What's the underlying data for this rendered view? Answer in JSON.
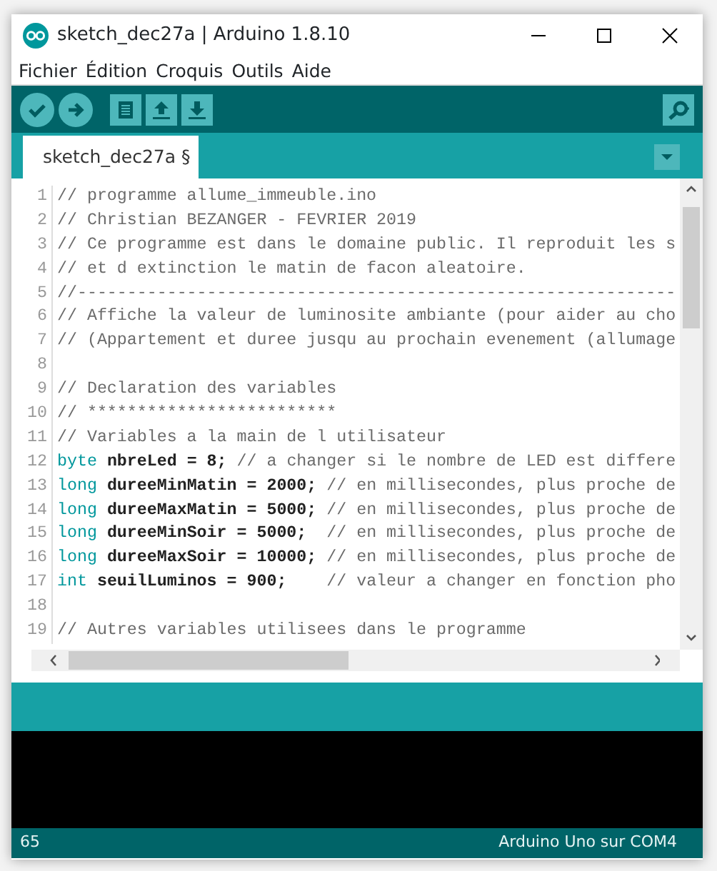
{
  "window": {
    "title": "sketch_dec27a | Arduino 1.8.10"
  },
  "menu": [
    "Fichier",
    "Édition",
    "Croquis",
    "Outils",
    "Aide"
  ],
  "tabs": [
    {
      "label": "sketch_dec27a §",
      "selected": true
    }
  ],
  "editor": {
    "lines": [
      {
        "number": "1",
        "segments": [
          {
            "kind": "comment",
            "text": "// programme allume_immeuble.ino"
          }
        ]
      },
      {
        "number": "2",
        "segments": [
          {
            "kind": "comment",
            "text": "// Christian BEZANGER - FEVRIER 2019"
          }
        ]
      },
      {
        "number": "3",
        "segments": [
          {
            "kind": "comment",
            "text": "// Ce programme est dans le domaine public. Il reproduit les s"
          }
        ]
      },
      {
        "number": "4",
        "segments": [
          {
            "kind": "comment",
            "text": "// et d extinction le matin de facon aleatoire."
          }
        ]
      },
      {
        "number": "5",
        "segments": [
          {
            "kind": "comment",
            "text": "//------------------------------------------------------------"
          }
        ]
      },
      {
        "number": "6",
        "segments": [
          {
            "kind": "comment",
            "text": "// Affiche la valeur de luminosite ambiante (pour aider au cho"
          }
        ]
      },
      {
        "number": "7",
        "segments": [
          {
            "kind": "comment",
            "text": "// (Appartement et duree jusqu au prochain evenement (allumage"
          }
        ]
      },
      {
        "number": "8"
      },
      {
        "number": "9",
        "segments": [
          {
            "kind": "comment",
            "text": "// Declaration des variables"
          }
        ]
      },
      {
        "number": "10",
        "segments": [
          {
            "kind": "comment",
            "text": "// *************************"
          }
        ]
      },
      {
        "number": "11",
        "segments": [
          {
            "kind": "comment",
            "text": "// Variables a la main de l utilisateur"
          }
        ]
      },
      {
        "number": "12",
        "segments": [
          {
            "kind": "keyword",
            "text": "byte"
          },
          {
            "kind": "code",
            "text": " nbreLed = 8; "
          },
          {
            "kind": "comment",
            "text": "// a changer si le nombre de LED est differe"
          }
        ]
      },
      {
        "number": "13",
        "segments": [
          {
            "kind": "keyword",
            "text": "long"
          },
          {
            "kind": "code",
            "text": " dureeMinMatin = 2000; "
          },
          {
            "kind": "comment",
            "text": "// en millisecondes, plus proche de"
          }
        ]
      },
      {
        "number": "14",
        "segments": [
          {
            "kind": "keyword",
            "text": "long"
          },
          {
            "kind": "code",
            "text": " dureeMaxMatin = 5000; "
          },
          {
            "kind": "comment",
            "text": "// en millisecondes, plus proche de"
          }
        ]
      },
      {
        "number": "15",
        "segments": [
          {
            "kind": "keyword",
            "text": "long"
          },
          {
            "kind": "code",
            "text": " dureeMinSoir = 5000;  "
          },
          {
            "kind": "comment",
            "text": "// en millisecondes, plus proche de"
          }
        ]
      },
      {
        "number": "16",
        "segments": [
          {
            "kind": "keyword",
            "text": "long"
          },
          {
            "kind": "code",
            "text": " dureeMaxSoir = 10000; "
          },
          {
            "kind": "comment",
            "text": "// en millisecondes, plus proche de"
          }
        ]
      },
      {
        "number": "17",
        "segments": [
          {
            "kind": "keyword",
            "text": "int"
          },
          {
            "kind": "code",
            "text": " seuilLuminos = 900;    "
          },
          {
            "kind": "comment",
            "text": "// valeur a changer en fonction pho"
          }
        ]
      },
      {
        "number": "18"
      },
      {
        "number": "19",
        "segments": [
          {
            "kind": "comment",
            "text": "// Autres variables utilisees dans le programme"
          }
        ]
      }
    ]
  },
  "status_bar": {
    "line": "65",
    "board": "Arduino Uno sur COM4"
  }
}
